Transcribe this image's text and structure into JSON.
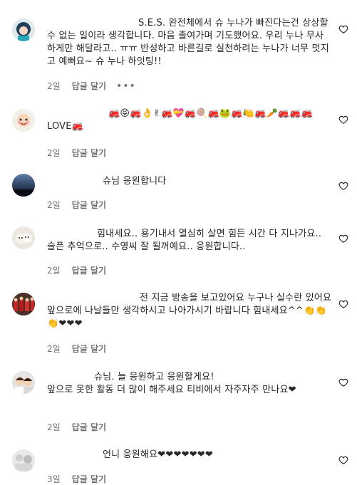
{
  "comments": [
    {
      "text": "S.E.S. 완전체에서 슈 누나가 빠진다는건 상상할 수 없는 일이라 생각합니다. 마음 졸여가며 기도했어요. 우리 누나 무사하게만 해달라고.. ㅠㅠ 반성하고 바른길로 실천하려는 누나가 너무 멋지고 예뻐요~ 슈 누나 하잇팅!!",
      "time": "2일",
      "reply": "답글 달기",
      "more": "•••"
    },
    {
      "text": "🚒😝🚒👌✌🚒💝🚒🍭🚒🐸🚒🍋🚒🥕🚒🚒🚒LOVE🚒",
      "time": "2일",
      "reply": "답글 달기"
    },
    {
      "text": "슈님 응원합니다",
      "time": "2일",
      "reply": "답글 달기"
    },
    {
      "text": "힘내세요.. 용기내서 열심히 살면 힘든 시간 다 지나가요.. 슬픈 추억으로.. 수영씨 잘 될꺼예요.. 응원합니다..",
      "time": "2일",
      "reply": "답글 달기"
    },
    {
      "text": "전 지금 방송을 보고있어요 누구나 실수란 있어요 앞으로에 나날들만 생각하시고 나아가시기 바랍니다 힘내세요^^👏👏👏❤❤❤",
      "time": "2일",
      "reply": "답글 달기"
    },
    {
      "text": "슈님. 늘 응원하고 응원할게요!\n앞으로 못한 활동 더 많이 해주세요 티비에서 자주자주 만나요❤",
      "time": "2일",
      "reply": "답글 달기"
    },
    {
      "text": "언니 응원해요❤❤❤❤❤❤❤",
      "time": "3일",
      "reply": "답글 달기"
    }
  ],
  "icons": {
    "like": "heart-outline-icon"
  }
}
